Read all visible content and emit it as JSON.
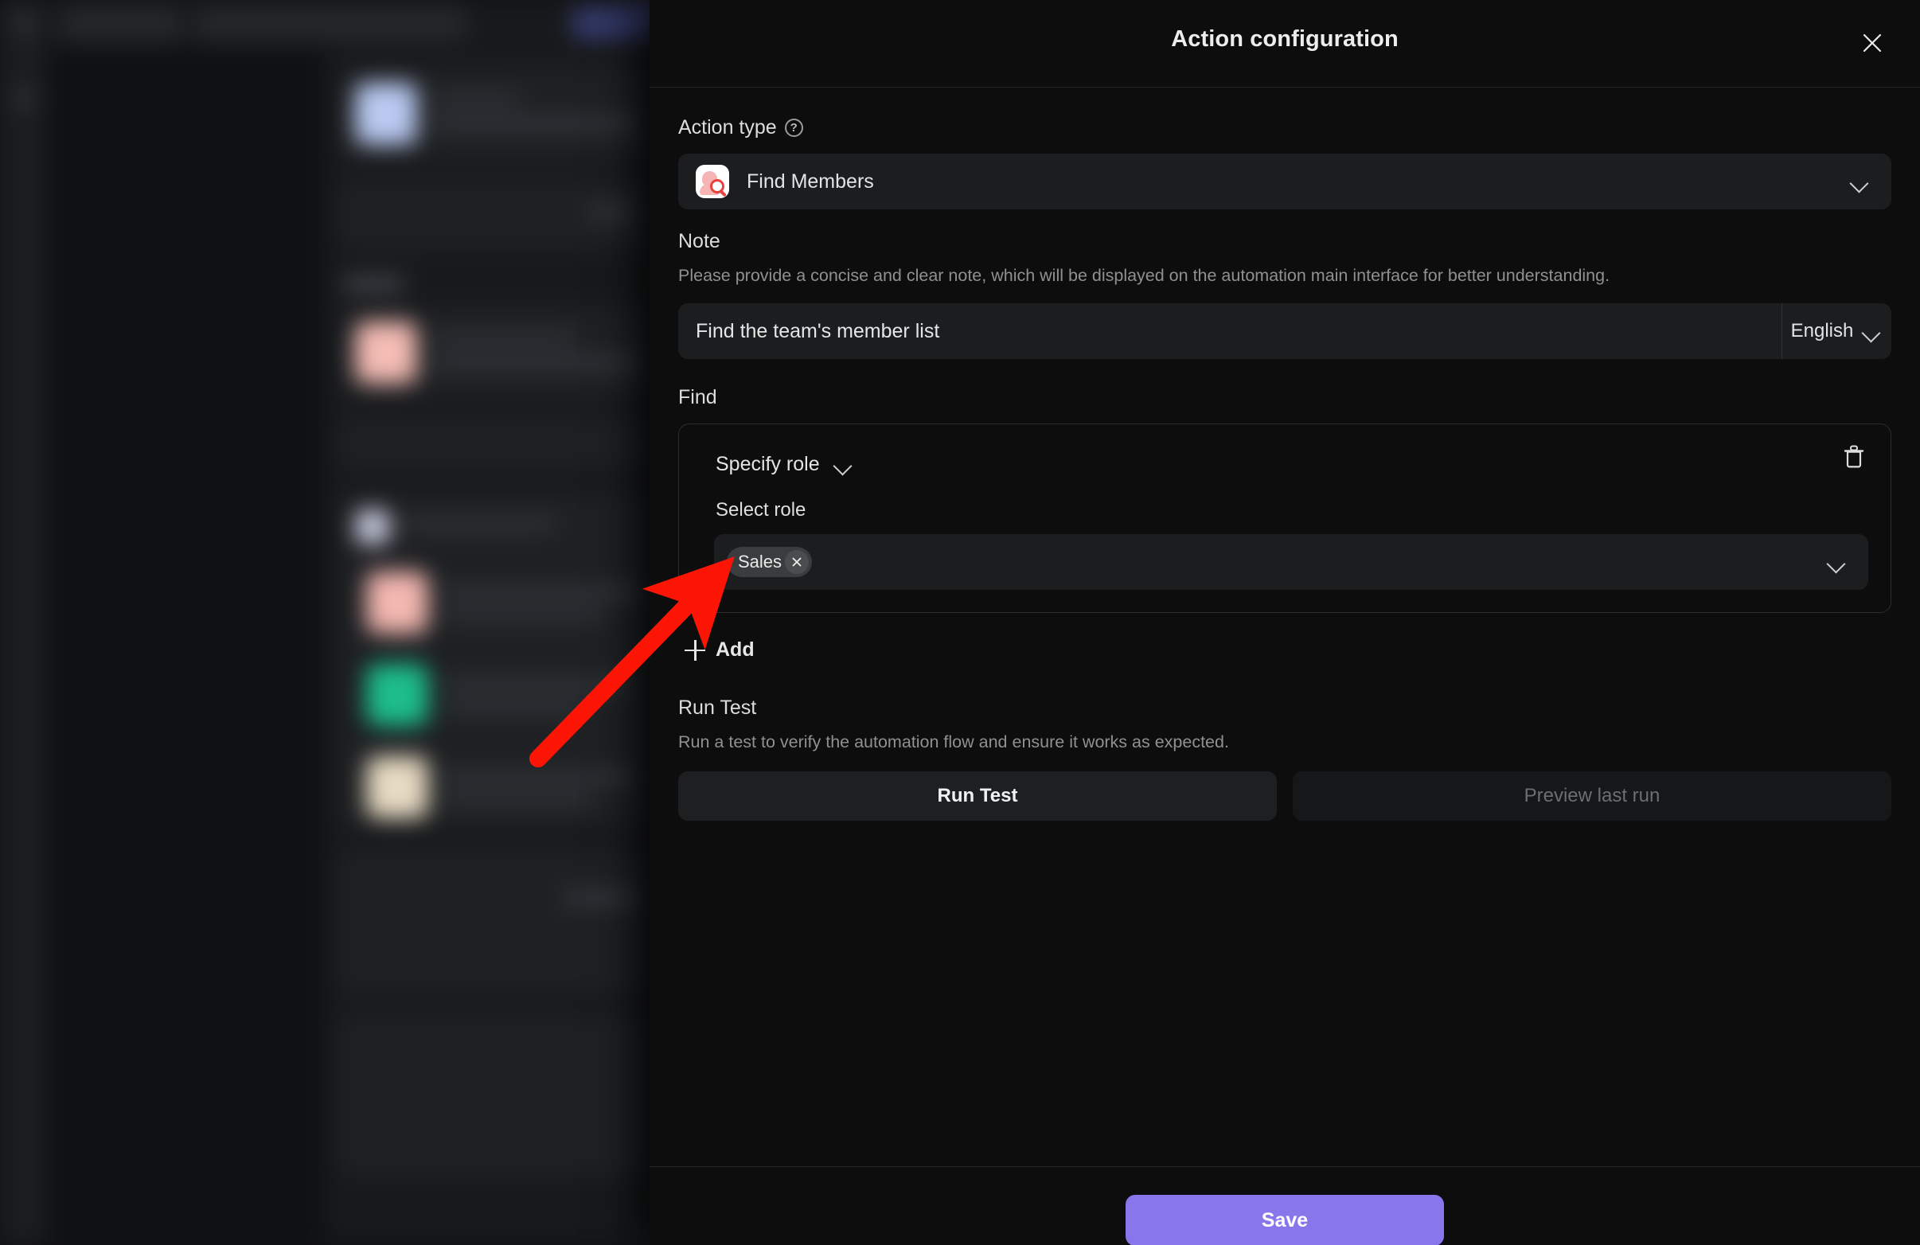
{
  "panel": {
    "title": "Action configuration",
    "close_icon": "close-icon"
  },
  "action_type": {
    "label": "Action type",
    "help_icon": "?",
    "selected": "Find Members",
    "icon": "find-members-icon",
    "chevron": "chevron-down-icon"
  },
  "note": {
    "label": "Note",
    "description": "Please provide a concise and clear note, which will be displayed on the automation main interface for better understanding.",
    "value": "Find the team's member list",
    "placeholder": "Enter a note",
    "language": "English"
  },
  "find": {
    "label": "Find",
    "condition": "Specify role",
    "sub_label": "Select role",
    "tags": [
      "Sales"
    ],
    "tag_remove_icon": "×",
    "delete_icon": "trash-icon",
    "add_label": "Add",
    "add_icon": "plus-icon"
  },
  "run_test": {
    "label": "Run Test",
    "description": "Run a test to verify the automation flow and ensure it works as expected.",
    "run_button": "Run Test",
    "preview_button": "Preview last run"
  },
  "footer": {
    "save_label": "Save"
  },
  "colors": {
    "accent": "#8877eb",
    "panel_bg": "#0d0d0e",
    "field_bg": "#1c1d1f",
    "annotation_arrow": "#fc1505"
  },
  "annotation": {
    "arrow": "red-arrow-pointing-to-select-role"
  }
}
